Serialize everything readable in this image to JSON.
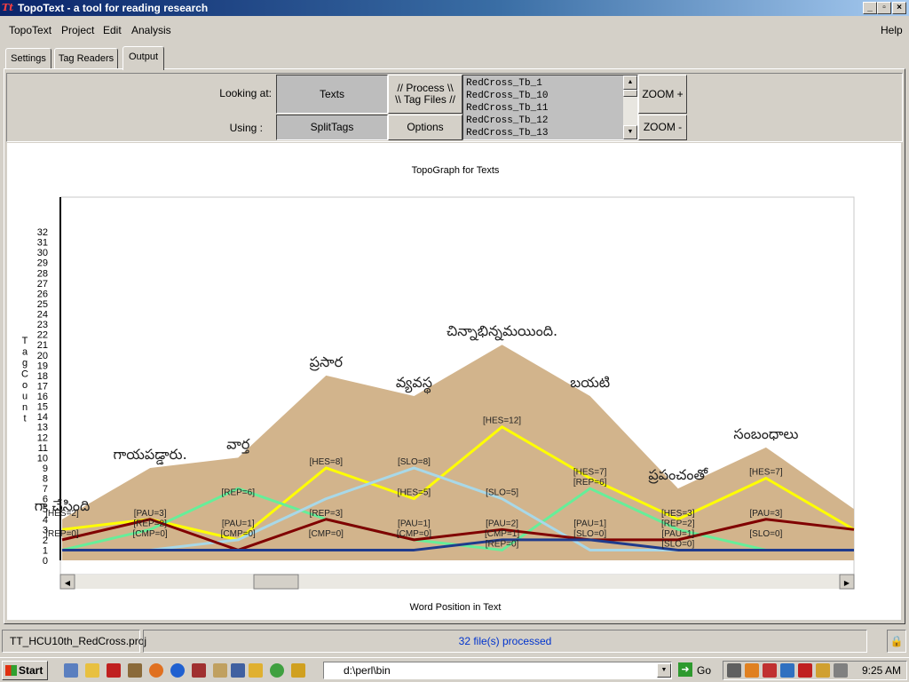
{
  "window": {
    "title": "TopoText - a tool for reading research",
    "icon_text": "Tt",
    "controls": [
      "minimize",
      "maximize",
      "close"
    ]
  },
  "menu": [
    "TopoText",
    "Project",
    "Edit",
    "Analysis",
    "Help"
  ],
  "tabs": [
    {
      "label": "Settings",
      "active": false
    },
    {
      "label": "Tag Readers",
      "active": false
    },
    {
      "label": "Output",
      "active": true
    }
  ],
  "controls": {
    "looking_at_label": "Looking at:",
    "using_label": "Using :",
    "texts_button": "Texts",
    "splittags_button": "SplitTags",
    "process_button_line1": "// Process \\\\",
    "process_button_line2": "\\\\ Tag Files //",
    "options_button": "Options",
    "zoom_in": "ZOOM +",
    "zoom_out": "ZOOM -",
    "files": [
      "RedCross_Tb_1",
      "RedCross_Tb_10",
      "RedCross_Tb_11",
      "RedCross_Tb_12",
      "RedCross_Tb_13"
    ]
  },
  "chart_data": {
    "type": "area",
    "title": "TopoGraph for Texts",
    "xlabel": "Word Position in Text",
    "ylabel": "TagCount",
    "ylim": [
      0,
      32
    ],
    "y_ticks": [
      0,
      1,
      2,
      3,
      4,
      5,
      6,
      7,
      8,
      9,
      10,
      11,
      12,
      13,
      14,
      15,
      16,
      17,
      18,
      19,
      20,
      21,
      22,
      23,
      24,
      25,
      26,
      27,
      28,
      29,
      30,
      31,
      32
    ],
    "x": [
      0,
      1,
      2,
      3,
      4,
      5,
      6,
      7,
      8,
      9
    ],
    "area": {
      "color": "#d2b48c",
      "values": [
        4,
        9,
        10,
        18,
        16,
        21,
        16,
        7,
        11,
        5
      ],
      "words": [
        "గా చేసింది",
        "గాయపడ్డారు.",
        "వార్త",
        "ప్రసార",
        "వ్యవస్థ",
        "చిన్నాభిన్నమయింది.",
        "బయటి",
        "ప్రపంచంతో",
        "సంబంధాలు",
        ""
      ]
    },
    "series": [
      {
        "name": "HES",
        "color": "#ffff00",
        "values": [
          3,
          4,
          2,
          9,
          6,
          13,
          8,
          4,
          8,
          3
        ]
      },
      {
        "name": "REP",
        "color": "#66ee99",
        "values": [
          1,
          3,
          7,
          4,
          2,
          1,
          7,
          3,
          1,
          1
        ]
      },
      {
        "name": "SLO",
        "color": "#a8d8e8",
        "values": [
          1,
          1,
          2,
          6,
          9,
          6,
          1,
          1,
          1,
          1
        ]
      },
      {
        "name": "PAU",
        "color": "#800000",
        "values": [
          2,
          4,
          1,
          4,
          2,
          3,
          2,
          2,
          4,
          3
        ]
      },
      {
        "name": "CMP",
        "color": "#1f3b8c",
        "values": [
          1,
          1,
          1,
          1,
          1,
          2,
          2,
          1,
          1,
          1
        ]
      }
    ],
    "labels": [
      {
        "x": 0,
        "y": 4,
        "text": "[HES=2]"
      },
      {
        "x": 0,
        "y": 2,
        "text": "[REP=0]"
      },
      {
        "x": 1,
        "y": 4,
        "text": "[PAU=3]"
      },
      {
        "x": 1,
        "y": 3,
        "text": "[REP=2]"
      },
      {
        "x": 1,
        "y": 2,
        "text": "[CMP=0]"
      },
      {
        "x": 2,
        "y": 6,
        "text": "[REP=6]"
      },
      {
        "x": 2,
        "y": 3,
        "text": "[PAU=1]"
      },
      {
        "x": 2,
        "y": 2,
        "text": "[CMP=0]"
      },
      {
        "x": 3,
        "y": 9,
        "text": "[HES=8]"
      },
      {
        "x": 3,
        "y": 4,
        "text": "[REP=3]"
      },
      {
        "x": 3,
        "y": 2,
        "text": "[CMP=0]"
      },
      {
        "x": 4,
        "y": 9,
        "text": "[SLO=8]"
      },
      {
        "x": 4,
        "y": 6,
        "text": "[HES=5]"
      },
      {
        "x": 4,
        "y": 3,
        "text": "[PAU=1]"
      },
      {
        "x": 4,
        "y": 2,
        "text": "[CMP=0]"
      },
      {
        "x": 5,
        "y": 13,
        "text": "[HES=12]"
      },
      {
        "x": 5,
        "y": 6,
        "text": "[SLO=5]"
      },
      {
        "x": 5,
        "y": 3,
        "text": "[PAU=2]"
      },
      {
        "x": 5,
        "y": 2,
        "text": "[CMP=1]"
      },
      {
        "x": 5,
        "y": 1,
        "text": "[REP=0]"
      },
      {
        "x": 6,
        "y": 8,
        "text": "[HES=7]"
      },
      {
        "x": 6,
        "y": 7,
        "text": "[REP=6]"
      },
      {
        "x": 6,
        "y": 3,
        "text": "[PAU=1]"
      },
      {
        "x": 6,
        "y": 2,
        "text": "[SLO=0]"
      },
      {
        "x": 7,
        "y": 4,
        "text": "[HES=3]"
      },
      {
        "x": 7,
        "y": 3,
        "text": "[REP=2]"
      },
      {
        "x": 7,
        "y": 2,
        "text": "[PAU=1]"
      },
      {
        "x": 7,
        "y": 1,
        "text": "[SLO=0]"
      },
      {
        "x": 8,
        "y": 8,
        "text": "[HES=7]"
      },
      {
        "x": 8,
        "y": 4,
        "text": "[PAU=3]"
      },
      {
        "x": 8,
        "y": 2,
        "text": "[SLO=0]"
      }
    ]
  },
  "status": {
    "project": "TT_HCU10th_RedCross.proj",
    "message": "32 file(s) processed"
  },
  "taskbar": {
    "start": "Start",
    "address": "d:\\perl\\bin",
    "go": "Go",
    "clock": "9:25 AM"
  }
}
